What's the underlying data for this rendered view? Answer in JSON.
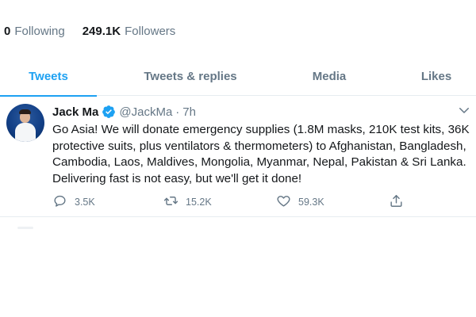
{
  "profile_stats": {
    "following_count": "0",
    "following_label": "Following",
    "followers_count": "249.1K",
    "followers_label": "Followers"
  },
  "tabs": [
    {
      "label": "Tweets",
      "active": true
    },
    {
      "label": "Tweets & replies",
      "active": false
    },
    {
      "label": "Media",
      "active": false
    },
    {
      "label": "Likes",
      "active": false
    }
  ],
  "tweet": {
    "author_name": "Jack Ma",
    "verified_icon": "verified-badge-icon",
    "handle": "@JackMa",
    "separator": "·",
    "time": "7h",
    "text": "Go Asia! We will donate emergency supplies (1.8M masks, 210K test kits, 36K protective suits, plus ventilators & thermometers) to Afghanistan, Bangladesh, Cambodia, Laos, Maldives, Mongolia, Myanmar, Nepal, Pakistan & Sri Lanka. Delivering fast is not easy, but we'll get it done!",
    "replies": "3.5K",
    "retweets": "15.2K",
    "likes": "59.3K"
  },
  "colors": {
    "accent": "#1da1f2",
    "secondary_text": "#657786",
    "primary_text": "#14171a",
    "divider": "#e6ecf0"
  }
}
